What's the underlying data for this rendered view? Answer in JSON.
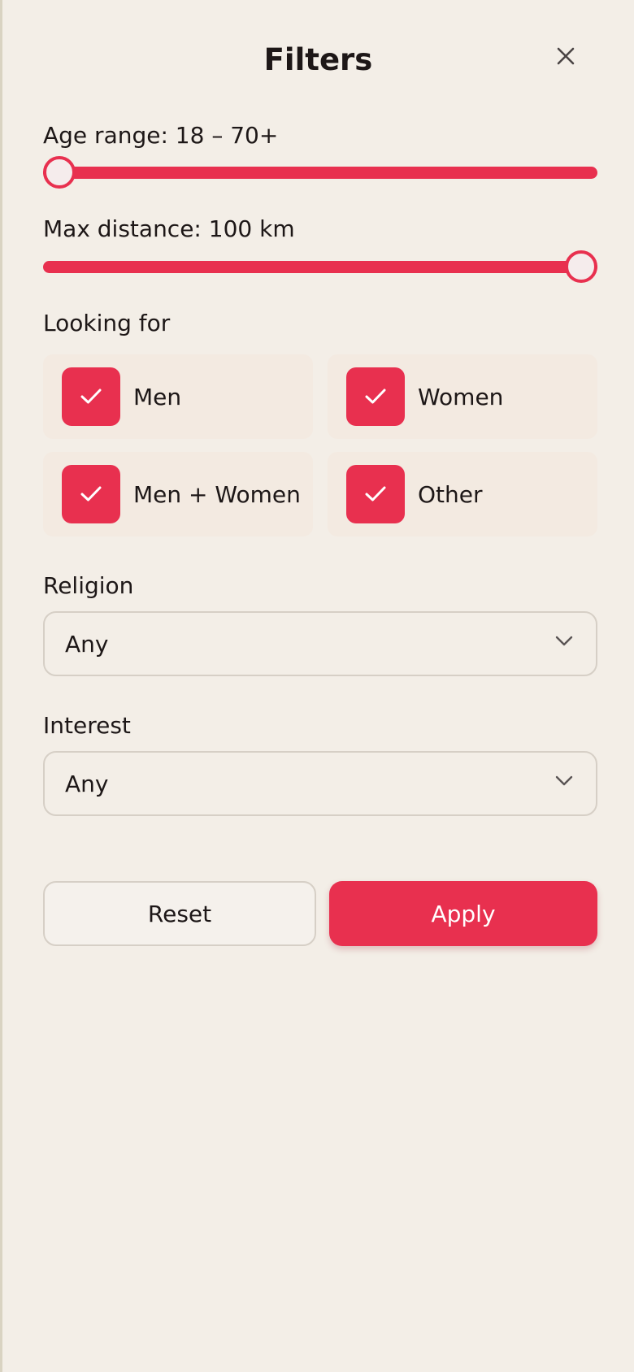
{
  "header": {
    "title": "Filters"
  },
  "age": {
    "label": "Age range: 18 – 70+",
    "min": 18,
    "max": "70+",
    "slider_level": 0.0
  },
  "distance": {
    "label": "Max distance: 100 km",
    "value_km": 100,
    "slider_level": 1.0
  },
  "looking_for": {
    "label": "Looking for",
    "options": [
      {
        "label": "Men",
        "checked": true
      },
      {
        "label": "Women",
        "checked": true
      },
      {
        "label": "Men + Women",
        "checked": true
      },
      {
        "label": "Other",
        "checked": true
      }
    ]
  },
  "religion": {
    "label": "Religion",
    "value": "Any"
  },
  "interest": {
    "label": "Interest",
    "value": "Any"
  },
  "actions": {
    "reset_label": "Reset",
    "apply_label": "Apply"
  },
  "colors": {
    "accent": "#e8304f",
    "background": "#f3eee7",
    "text": "#1d1717"
  },
  "icons": {
    "close": "close-icon",
    "check": "check-icon",
    "dropdown": "chevron-down-icon"
  }
}
